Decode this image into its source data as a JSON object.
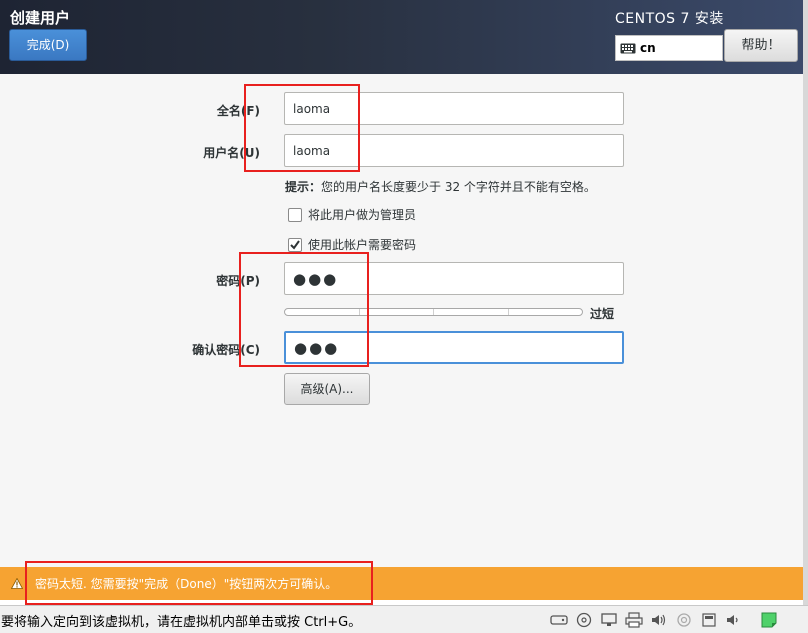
{
  "window": {
    "title": "创建用户",
    "product": "CENTOS 7 安装",
    "done_label": "完成(D)",
    "help_label": "帮助！",
    "keyboard_layout": "cn"
  },
  "form": {
    "fullname": {
      "label": "全名(F)",
      "value": "laoma"
    },
    "username": {
      "label": "用户名(U)",
      "value": "laoma"
    },
    "hint_prefix": "提示：",
    "hint_text": "您的用户名长度要少于 32 个字符并且不能有空格。",
    "admin_checkbox": {
      "label": "将此用户做为管理员",
      "checked": false
    },
    "password_required_checkbox": {
      "label": "使用此帐户需要密码",
      "checked": true
    },
    "password": {
      "label": "密码(P)",
      "value": "●●●"
    },
    "strength": {
      "label": "过短",
      "level": 0
    },
    "confirm": {
      "label": "确认密码(C)",
      "value": "●●●"
    },
    "advanced_label": "高级(A)..."
  },
  "warning": {
    "text": "密码太短. 您需要按\"完成（Done）\"按钮两次方可确认。",
    "color": "#f6a332"
  },
  "host_status": {
    "message": "要将输入定向到该虚拟机，请在虚拟机内部单击或按 Ctrl+G。",
    "icons": [
      "hard-disk-icon",
      "cd-drive-icon",
      "network-icon",
      "printer-icon",
      "sound-icon",
      "usb-icon",
      "display-icon",
      "volume-icon",
      "note-icon"
    ]
  },
  "colors": {
    "accent": "#4a90d9",
    "warning": "#f6a332",
    "annotation": "#e8201e"
  }
}
